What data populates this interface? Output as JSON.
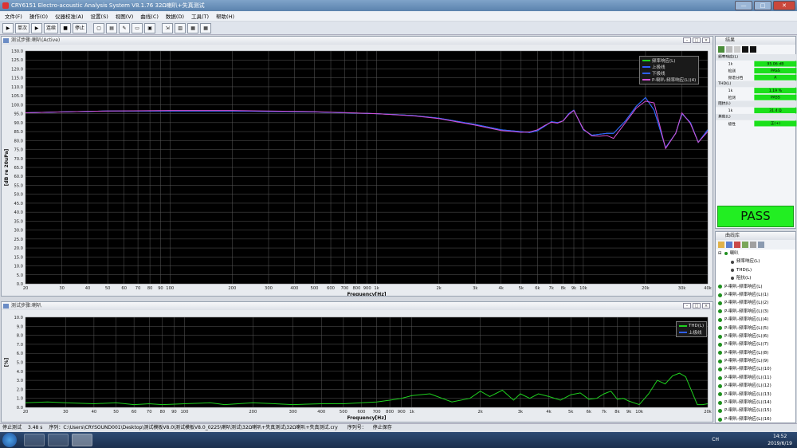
{
  "window": {
    "title": "CRY6151 Electro-acoustic Analysis System  V8.1.76 32Ω喇叭+失真测试",
    "controls": [
      "—",
      "□",
      "✕"
    ]
  },
  "menu": [
    "文件(F)",
    "操作(O)",
    "仪器校准(A)",
    "设置(S)",
    "视图(V)",
    "曲线(C)",
    "数据(D)",
    "工具(T)",
    "帮助(H)"
  ],
  "toolbar": {
    "single_label": "单次",
    "continuous_label": "连续",
    "stop_label": "停止"
  },
  "top_chart": {
    "panel_title": "测试步骤:喇叭(Active)",
    "legend": [
      {
        "name": "频率响应(L)",
        "color": "#1fd11f"
      },
      {
        "name": "上极线",
        "color": "#2f5fff"
      },
      {
        "name": "下极线",
        "color": "#2f5fff"
      },
      {
        "name": "P-喇叭-频率响应(L)(4)",
        "color": "#d44fd4"
      }
    ],
    "chart_data": {
      "type": "line",
      "xlabel": "Frequency[Hz]",
      "ylabel": "[dB re 20uPa]",
      "xscale": "log",
      "xlim": [
        20,
        40000
      ],
      "ylim": [
        0,
        130
      ],
      "yticks": [
        "130.0",
        "125.0",
        "120.0",
        "115.0",
        "110.0",
        "105.0",
        "100.0",
        "95.0",
        "90.0",
        "85.0",
        "80.0",
        "75.0",
        "70.0",
        "65.0",
        "60.0",
        "55.0",
        "50.0",
        "45.0",
        "40.0",
        "35.0",
        "30.0",
        "25.0",
        "20.0",
        "15.0",
        "10.0",
        "5.0",
        "0.0"
      ],
      "xticks": [
        {
          "v": 20,
          "t": "20"
        },
        {
          "v": 30,
          "t": "30"
        },
        {
          "v": 40,
          "t": "40"
        },
        {
          "v": 50,
          "t": "50"
        },
        {
          "v": 60,
          "t": "60"
        },
        {
          "v": 70,
          "t": "70"
        },
        {
          "v": 80,
          "t": "80"
        },
        {
          "v": 90,
          "t": "90"
        },
        {
          "v": 100,
          "t": "100"
        },
        {
          "v": 200,
          "t": "200"
        },
        {
          "v": 300,
          "t": "300"
        },
        {
          "v": 400,
          "t": "400"
        },
        {
          "v": 500,
          "t": "500"
        },
        {
          "v": 600,
          "t": "600"
        },
        {
          "v": 700,
          "t": "700"
        },
        {
          "v": 800,
          "t": "800"
        },
        {
          "v": 900,
          "t": "900"
        },
        {
          "v": 1000,
          "t": "1k"
        },
        {
          "v": 2000,
          "t": "2k"
        },
        {
          "v": 3000,
          "t": "3k"
        },
        {
          "v": 4000,
          "t": "4k"
        },
        {
          "v": 5000,
          "t": "5k"
        },
        {
          "v": 6000,
          "t": "6k"
        },
        {
          "v": 7000,
          "t": "7k"
        },
        {
          "v": 8000,
          "t": "8k"
        },
        {
          "v": 9000,
          "t": "9k"
        },
        {
          "v": 10000,
          "t": "10k"
        },
        {
          "v": 20000,
          "t": "20k"
        },
        {
          "v": 30000,
          "t": "30k"
        },
        {
          "v": 40000,
          "t": "40k"
        }
      ],
      "series": [
        {
          "name": "频率响应(L)",
          "color": "#1fd11f",
          "x": [
            20,
            30,
            50,
            100,
            200,
            300,
            500,
            700,
            1000,
            1500,
            2000,
            3000,
            4000,
            5000,
            5500,
            6000,
            6500,
            7000,
            7500,
            8000,
            8500,
            9000,
            10000,
            11000,
            12000,
            13000,
            14000,
            16000,
            18000,
            20000,
            22000,
            25000,
            28000,
            30000,
            33000,
            36000,
            40000
          ],
          "y": [
            95.5,
            96,
            96.5,
            96.5,
            96.5,
            96.3,
            96,
            95.5,
            95,
            94,
            92.5,
            89,
            86,
            85,
            84.5,
            85.5,
            88,
            90.5,
            90,
            91,
            95,
            97,
            86,
            83,
            83.5,
            84,
            84,
            91,
            99,
            104,
            97,
            76,
            84,
            95,
            90,
            79,
            86
          ]
        },
        {
          "name": "上极线",
          "color": "#2f5fff",
          "x": [
            20,
            30,
            50,
            100,
            200,
            300,
            500,
            700,
            1000,
            1500,
            2000,
            3000,
            4000,
            5000,
            5500,
            6000,
            6500,
            7000,
            7500,
            8000,
            8500,
            9000,
            10000,
            11000,
            12000,
            13000,
            14000,
            16000,
            18000,
            20000,
            22000,
            25000,
            28000,
            30000,
            33000,
            36000,
            40000
          ],
          "y": [
            95.5,
            96,
            96.5,
            96.5,
            96.5,
            96.3,
            96,
            95.5,
            95,
            94,
            92.5,
            89,
            86,
            85,
            84.5,
            85.5,
            88,
            90.5,
            90,
            91,
            95,
            97,
            86,
            83,
            83.5,
            84,
            84,
            91,
            99,
            104,
            97,
            76,
            84,
            95,
            90,
            79,
            86
          ]
        },
        {
          "name": "下极线",
          "color": "#2f5fff",
          "x": [
            20,
            30,
            50,
            100,
            200,
            300,
            500,
            700,
            1000,
            1500,
            2000,
            3000,
            4000,
            5000,
            5500,
            6000,
            6500,
            7000,
            7500,
            8000,
            8500,
            9000,
            10000,
            11000,
            12000,
            13000,
            14000,
            16000,
            18000,
            20000,
            22000,
            25000,
            28000,
            30000,
            33000,
            36000,
            40000
          ],
          "y": [
            95.5,
            96,
            96.5,
            96.5,
            96.5,
            96.3,
            96,
            95.5,
            95,
            94,
            92.5,
            89,
            86,
            85,
            84.5,
            85.5,
            88,
            90.5,
            90,
            91,
            95,
            97,
            86,
            83,
            83.5,
            84,
            84,
            91,
            99,
            104,
            97,
            76,
            84,
            95,
            90,
            79,
            86
          ]
        },
        {
          "name": "P-喇叭-频率响应(L)(4)",
          "color": "#d44fd4",
          "x": [
            20,
            30,
            50,
            100,
            200,
            300,
            500,
            700,
            1000,
            1500,
            2000,
            3000,
            4000,
            5000,
            5500,
            6000,
            6500,
            7000,
            7500,
            8000,
            8500,
            9000,
            10000,
            11000,
            12000,
            13000,
            14000,
            16000,
            18000,
            20000,
            22000,
            25000,
            28000,
            30000,
            33000,
            36000,
            40000
          ],
          "y": [
            95.5,
            96,
            96.5,
            96.8,
            96.8,
            96.5,
            96.1,
            95.6,
            95,
            93.8,
            92.3,
            88.6,
            85.6,
            84.6,
            84.8,
            86,
            88.4,
            90.2,
            89.7,
            91,
            94.6,
            96.8,
            86.4,
            82.6,
            82.4,
            82.8,
            81.2,
            90,
            98,
            102,
            101,
            75.5,
            84,
            95.5,
            89.5,
            79,
            85
          ]
        }
      ]
    }
  },
  "bottom_chart": {
    "panel_title": "测试步骤:喇叭",
    "legend": [
      {
        "name": "THD(L)",
        "color": "#1fd11f"
      },
      {
        "name": "上极线",
        "color": "#2f5fff"
      }
    ],
    "chart_data": {
      "type": "line",
      "xlabel": "Frequency[Hz]",
      "ylabel": "[%]",
      "xscale": "log",
      "xlim": [
        20,
        20000
      ],
      "ylim": [
        0,
        10
      ],
      "yticks": [
        "10.0",
        "9.0",
        "8.0",
        "7.0",
        "6.0",
        "5.0",
        "4.0",
        "3.0",
        "2.0",
        "1.0",
        "0.0"
      ],
      "xticks": [
        {
          "v": 20,
          "t": "20"
        },
        {
          "v": 30,
          "t": "30"
        },
        {
          "v": 40,
          "t": "40"
        },
        {
          "v": 50,
          "t": "50"
        },
        {
          "v": 60,
          "t": "60"
        },
        {
          "v": 70,
          "t": "70"
        },
        {
          "v": 80,
          "t": "80"
        },
        {
          "v": 90,
          "t": "90"
        },
        {
          "v": 100,
          "t": "100"
        },
        {
          "v": 200,
          "t": "200"
        },
        {
          "v": 300,
          "t": "300"
        },
        {
          "v": 400,
          "t": "400"
        },
        {
          "v": 500,
          "t": "500"
        },
        {
          "v": 600,
          "t": "600"
        },
        {
          "v": 700,
          "t": "700"
        },
        {
          "v": 800,
          "t": "800"
        },
        {
          "v": 900,
          "t": "900"
        },
        {
          "v": 1000,
          "t": "1k"
        },
        {
          "v": 2000,
          "t": "2k"
        },
        {
          "v": 3000,
          "t": "3k"
        },
        {
          "v": 4000,
          "t": "4k"
        },
        {
          "v": 5000,
          "t": "5k"
        },
        {
          "v": 6000,
          "t": "6k"
        },
        {
          "v": 7000,
          "t": "7k"
        },
        {
          "v": 8000,
          "t": "8k"
        },
        {
          "v": 9000,
          "t": "9k"
        },
        {
          "v": 10000,
          "t": "10k"
        },
        {
          "v": 20000,
          "t": "20k"
        }
      ],
      "series": [
        {
          "name": "THD(L)",
          "color": "#1fd11f",
          "x": [
            20,
            25,
            30,
            40,
            50,
            60,
            70,
            80,
            100,
            130,
            150,
            200,
            250,
            300,
            400,
            500,
            600,
            700,
            800,
            900,
            1000,
            1200,
            1500,
            1800,
            2000,
            2200,
            2500,
            2800,
            3000,
            3300,
            3600,
            4000,
            4500,
            5000,
            5500,
            6000,
            6500,
            7000,
            7500,
            8000,
            8500,
            9000,
            10000,
            11000,
            12000,
            13000,
            14000,
            15000,
            16000,
            18000,
            19000,
            20000
          ],
          "y": [
            0.5,
            0.6,
            0.5,
            0.4,
            0.5,
            0.3,
            0.4,
            0.3,
            0.4,
            0.5,
            0.3,
            0.5,
            0.4,
            0.3,
            0.4,
            0.4,
            0.5,
            0.6,
            0.8,
            1.0,
            1.3,
            1.5,
            0.6,
            1.0,
            1.8,
            1.2,
            1.9,
            0.8,
            1.5,
            1.0,
            1.5,
            1.2,
            0.8,
            1.4,
            1.6,
            0.9,
            1.0,
            1.5,
            1.8,
            0.9,
            1.0,
            0.7,
            0.3,
            1.5,
            3.0,
            2.6,
            3.5,
            3.8,
            3.4,
            0.3,
            0.3,
            0.4
          ]
        },
        {
          "name": "上极线",
          "color": "#2f5fff",
          "x": [],
          "y": []
        }
      ]
    }
  },
  "right_panel": {
    "title": "结果",
    "groups": [
      {
        "name": "频率响应(L)",
        "rows": [
          {
            "label": "1k",
            "value": "95.06 dB"
          },
          {
            "label": "检测",
            "value": "PASS"
          },
          {
            "label": "频谱分档",
            "value": "A"
          }
        ]
      },
      {
        "name": "THD(L)",
        "rows": [
          {
            "label": "1k",
            "value": "1.19 %"
          },
          {
            "label": "检测",
            "value": "PASS"
          }
        ]
      },
      {
        "name": "阻抗(L)",
        "rows": [
          {
            "label": "1k",
            "value": "31.4 Ω"
          }
        ]
      },
      {
        "name": "其他(L)",
        "rows": [
          {
            "label": "极性",
            "value": "正(+)"
          }
        ]
      }
    ],
    "result_banner": "PASS",
    "result_color": "#22ee22"
  },
  "curve_list": {
    "title": "曲线库",
    "root": "喇叭",
    "children": [
      "频率响应(L)",
      "THD(L)",
      "阻抗(L)"
    ],
    "items": [
      "P-喇叭-频率响应(L)",
      "P-喇叭-频率响应(L)(1)",
      "P-喇叭-频率响应(L)(2)",
      "P-喇叭-频率响应(L)(3)",
      "P-喇叭-频率响应(L)(4)",
      "P-喇叭-频率响应(L)(5)",
      "P-喇叭-频率响应(L)(6)",
      "P-喇叭-频率响应(L)(7)",
      "P-喇叭-频率响应(L)(8)",
      "P-喇叭-频率响应(L)(9)",
      "P-喇叭-频率响应(L)(10)",
      "P-喇叭-频率响应(L)(11)",
      "P-喇叭-频率响应(L)(12)",
      "P-喇叭-频率响应(L)(13)",
      "P-喇叭-频率响应(L)(14)",
      "P-喇叭-频率响应(L)(15)",
      "P-喇叭-频率响应(L)(16)"
    ]
  },
  "statusbar": {
    "state": "停止测试",
    "time": "3.48 s",
    "sequence": "序列：C:\\Users\\CRYSOUND001\\Desktop\\测试模板V8.0\\测试模板V8.0_0225\\喇叭测试\\32Ω喇叭+失真测试\\32Ω喇叭+失真测试.cry",
    "serial_label": "序列号：",
    "serial_state": "停止保存"
  },
  "taskbar": {
    "time": "14:52",
    "date": "2019/6/19",
    "ime": "CH"
  }
}
